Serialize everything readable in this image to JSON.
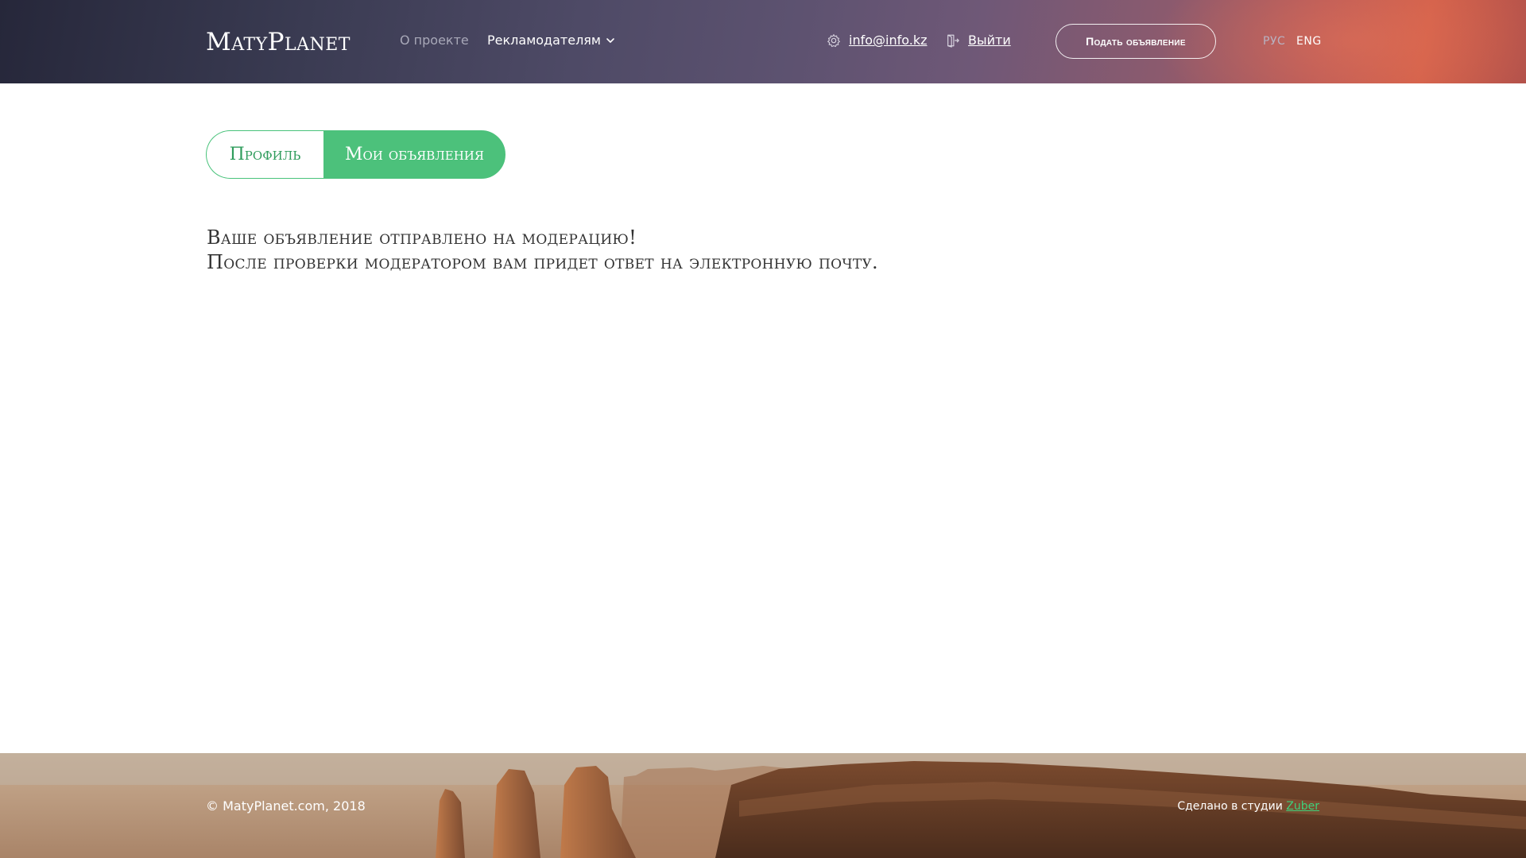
{
  "header": {
    "logo": "MatyPlanet",
    "nav": {
      "about": "О проекте",
      "advertisers": "Рекламодателям"
    },
    "email": "info@info.kz",
    "logout": "Выйти",
    "post_button": "Подать объявление",
    "languages": [
      "РУС",
      "ENG"
    ],
    "active_language": "ENG"
  },
  "tabs": [
    {
      "label": "Профиль",
      "active": false
    },
    {
      "label": "Мои объявления",
      "active": true
    }
  ],
  "message": {
    "line1": "Ваше объявление отправлено на модерацию!",
    "line2": "После проверки модератором вам придет ответ на электронную почту."
  },
  "footer": {
    "copyright": "© MatyPlanet.com, 2018",
    "credits_text": "Сделано в студии",
    "studio": "Zuber"
  },
  "colors": {
    "accent_green": "#4cc17b",
    "link_green": "#3fd07a",
    "text_dark": "#333333"
  }
}
